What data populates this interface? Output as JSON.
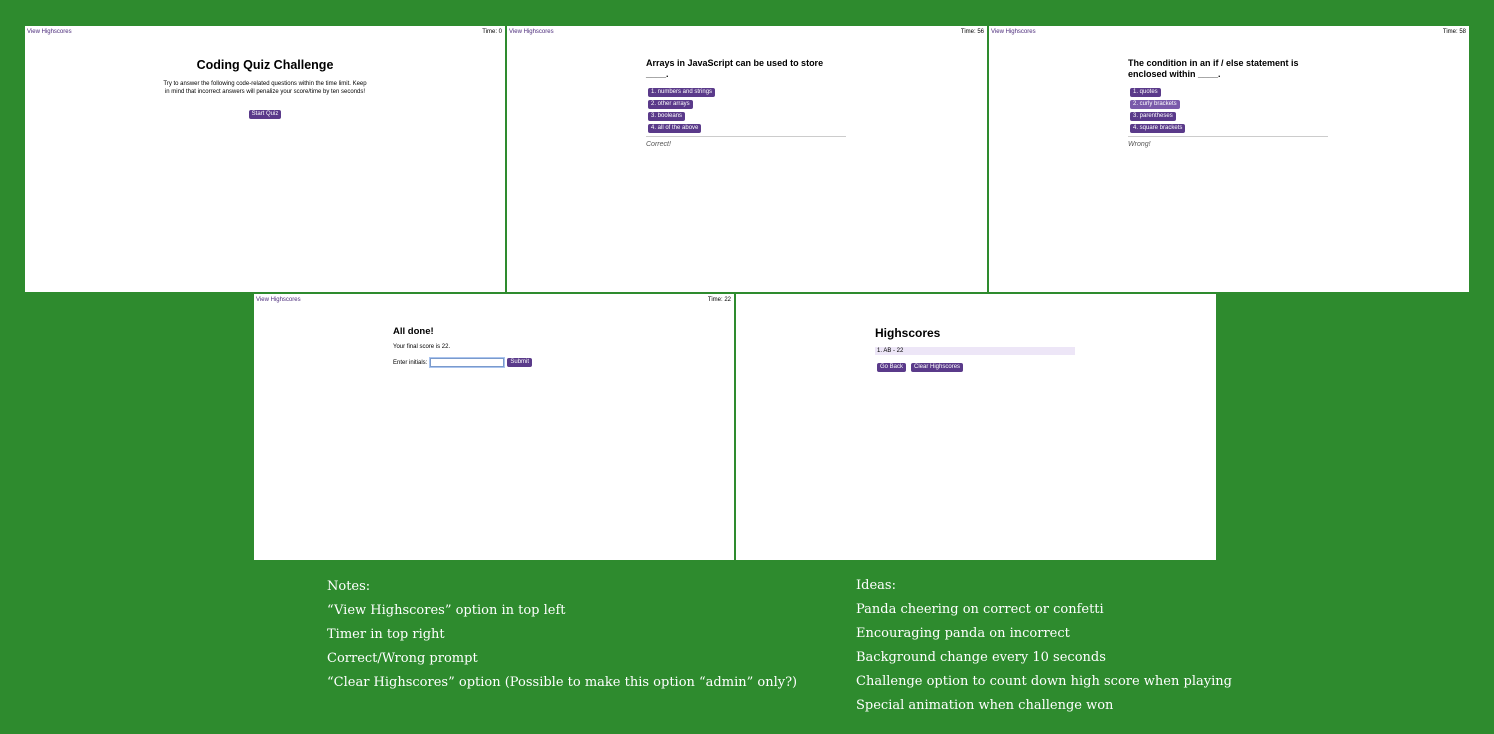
{
  "colors": {
    "background": "#2e8b2e",
    "accent": "#5a3a8a",
    "link": "#4a2a7a",
    "score_row": "#ede6f7"
  },
  "panels": {
    "start": {
      "view_highscores": "View Highscores",
      "timer": "Time: 0",
      "title": "Coding Quiz Challenge",
      "description": "Try to answer the following code-related questions within the time limit. Keep in mind that incorrect answers will penalize your score/time by ten seconds!",
      "start_button": "Start Quiz"
    },
    "q1": {
      "view_highscores": "View Highscores",
      "timer": "Time: 56",
      "question": "Arrays in JavaScript can be used to store ____.",
      "answers": [
        "1. numbers and strings",
        "2. other arrays",
        "3. booleans",
        "4. all of the above"
      ],
      "feedback": "Correct!"
    },
    "q2": {
      "view_highscores": "View Highscores",
      "timer": "Time: 58",
      "question": "The condition in an if / else statement is enclosed within ____.",
      "answers": [
        "1. quotes",
        "2. curly brackets",
        "3. parentheses",
        "4. square brackets"
      ],
      "feedback": "Wrong!"
    },
    "done": {
      "view_highscores": "View Highscores",
      "timer": "Time: 22",
      "title": "All done!",
      "score_text": "Your final score is 22.",
      "initials_label": "Enter initials:",
      "initials_value": "",
      "submit_button": "Submit"
    },
    "scores": {
      "title": "Highscores",
      "entries": [
        "1. AB - 22"
      ],
      "go_back_button": "Go Back",
      "clear_button": "Clear Highscores"
    }
  },
  "notes": {
    "heading": "Notes:",
    "items": [
      "“View Highscores” option in top left",
      "Timer in top right",
      "Correct/Wrong prompt",
      "“Clear Highscores” option (Possible to make this option “admin” only?)"
    ]
  },
  "ideas": {
    "heading": "Ideas:",
    "items": [
      "Panda cheering on correct or confetti",
      "Encouraging panda on incorrect",
      "Background change every 10 seconds",
      "Challenge option to count down high score when playing",
      "Special animation when challenge won"
    ]
  }
}
